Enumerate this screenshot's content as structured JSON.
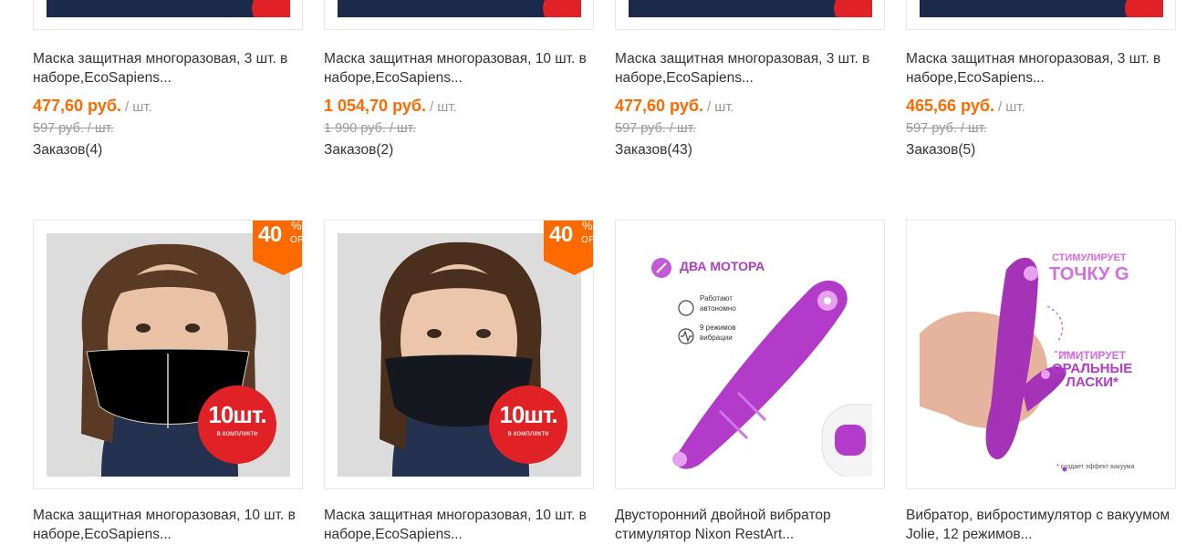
{
  "products_top": [
    {
      "title": "Маска защитная многоразовая, 3 шт. в наборе,EcoSapiens...",
      "price": "477,60 руб.",
      "unit": "/ шт.",
      "old_price": "597 руб. / шт.",
      "orders": "Заказов(4)"
    },
    {
      "title": "Маска защитная многоразовая, 10 шт. в наборе,EcoSapiens...",
      "price": "1 054,70 руб.",
      "unit": "/ шт.",
      "old_price": "1 990 руб. / шт.",
      "orders": "Заказов(2)"
    },
    {
      "title": "Маска защитная многоразовая, 3 шт. в наборе,EcoSapiens...",
      "price": "477,60 руб.",
      "unit": "/ шт.",
      "old_price": "597 руб. / шт.",
      "orders": "Заказов(43)"
    },
    {
      "title": "Маска защитная многоразовая, 3 шт. в наборе,EcoSapiens...",
      "price": "465,66 руб.",
      "unit": "/ шт.",
      "old_price": "597 руб. / шт.",
      "orders": "Заказов(5)"
    }
  ],
  "products_bottom": [
    {
      "title": "Маска защитная многоразовая, 10 шт. в наборе,EcoSapiens...",
      "discount": "40",
      "pct": "%",
      "off": "OFF",
      "count_badge": "10шт.",
      "count_sub": "в комплекте",
      "mask_color": "#f4f1ea"
    },
    {
      "title": "Маска защитная многоразовая, 10 шт. в наборе,EcoSapiens...",
      "discount": "40",
      "pct": "%",
      "off": "OFF",
      "count_badge": "10шт.",
      "count_sub": "в комплекте",
      "mask_color": "#15181f"
    },
    {
      "title": "Двусторонний двойной вибратор стимулятор Nixon RestArt...",
      "img_text": {
        "headline": "ДВА МОТОРА",
        "feature1": "Работают автономно",
        "feature2": "9 режимов вибрации"
      }
    },
    {
      "title": "Вибратор, вибростимулятор с вакуумом Jolie, 12 режимов...",
      "img_text": {
        "line1": "СТИМУЛИРУЕТ",
        "line2": "ТОЧКУ G",
        "line3": "ИМИТИРУЕТ",
        "line4": "ОРАЛЬНЫЕ",
        "line5": "ЛАСКИ*",
        "footnote": "* создает эффект вакуума"
      }
    }
  ],
  "colors": {
    "accent": "#ff6a00",
    "badge_red": "#e02126",
    "purple": "#b23cc9"
  }
}
